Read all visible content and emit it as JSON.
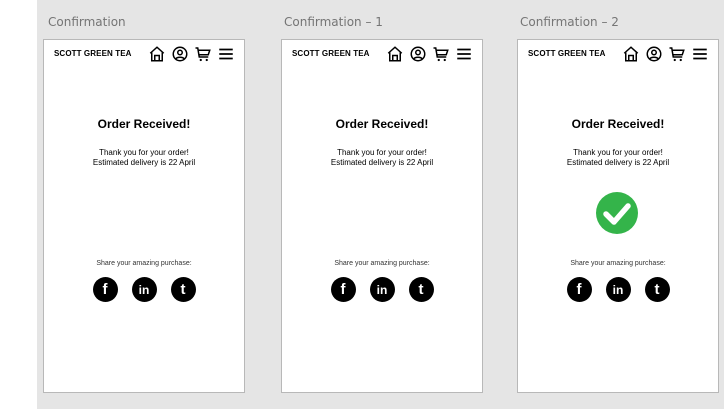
{
  "frames": [
    {
      "label": "Confirmation",
      "show_check": false
    },
    {
      "label": "Confirmation – 1",
      "show_check": false
    },
    {
      "label": "Confirmation – 2",
      "show_check": true
    }
  ],
  "brand": "SCOTT GREEN TEA",
  "order": {
    "title": "Order Received!",
    "thanks": "Thank you for your order!",
    "delivery": "Estimated delivery is 22 April"
  },
  "share": {
    "label": "Share your amazing purchase:",
    "facebook": "f",
    "linkedin": "in",
    "tumblr": "t"
  },
  "icons": [
    "home-icon",
    "account-icon",
    "cart-icon",
    "menu-icon",
    "checkmark-icon",
    "arrow-right-icon"
  ],
  "colors": {
    "canvas": "#e5e5e5",
    "check_green": "#34b44a"
  }
}
